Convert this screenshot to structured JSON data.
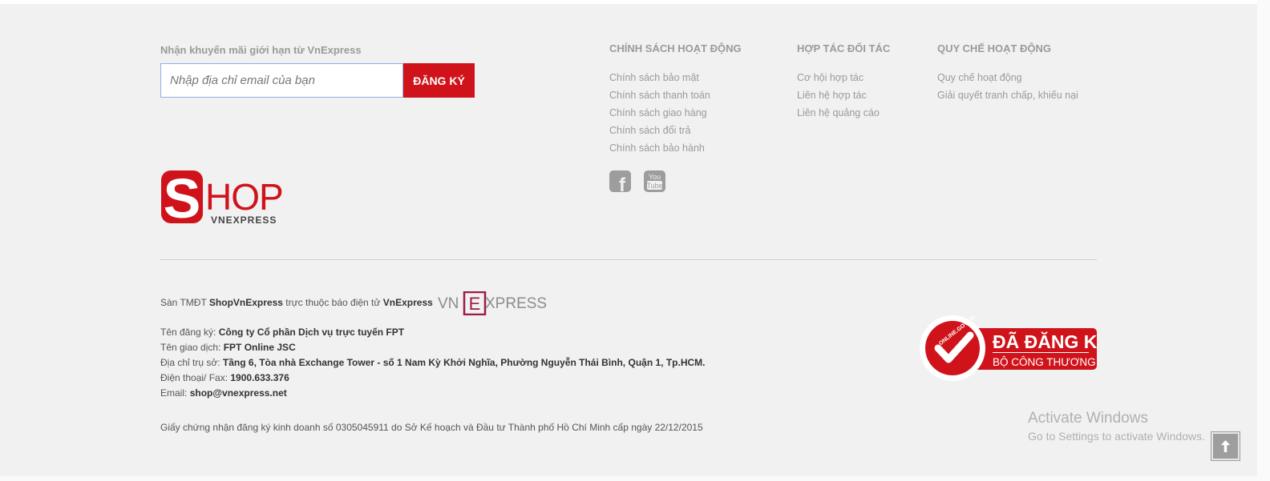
{
  "newsletter": {
    "title": "Nhận khuyến mãi giới hạn từ VnExpress",
    "placeholder": "Nhập địa chỉ email của bạn",
    "button_label": "ĐĂNG KÝ"
  },
  "logo": {
    "letter": "S",
    "word": "HOP",
    "sub": "VNEXPRESS"
  },
  "columns": [
    {
      "title": "CHÍNH SÁCH HOẠT ĐỘNG",
      "links": [
        "Chính sách bảo mật",
        "Chính sách thanh toán",
        "Chính sách giao hàng",
        "Chính sách đổi trả",
        "Chính sách bảo hành"
      ]
    },
    {
      "title": "HỢP TÁC ĐỐI TÁC",
      "links": [
        "Cơ hội hợp tác",
        "Liên hệ hợp tác",
        "Liên hệ quảng cáo"
      ]
    },
    {
      "title": "QUY CHẾ HOẠT ĐỘNG",
      "links": [
        "Quy chế hoạt động",
        "Giải quyết tranh chấp, khiếu nại"
      ]
    }
  ],
  "social": {
    "facebook_glyph": "f",
    "youtube_line1": "You",
    "youtube_line2": "Tube"
  },
  "company": {
    "intro_prefix": "Sàn TMĐT ",
    "intro_brand": "ShopVnExpress",
    "intro_mid": " trực thuộc báo điện tử ",
    "intro_paper": "VnExpress",
    "vne_logo_left": "VN",
    "vne_logo_mid": "E",
    "vne_logo_right": "XPRESS",
    "reg_name_label": "Tên đăng ký: ",
    "reg_name": "Công ty Cổ phần Dịch vụ trực tuyến FPT",
    "trade_name_label": "Tên giao dịch: ",
    "trade_name": "FPT Online JSC",
    "address_label": "Địa chỉ trụ sở: ",
    "address": "Tầng 6, Tòa nhà Exchange Tower - số 1 Nam Kỳ Khởi Nghĩa, Phường Nguyễn Thái Bình, Quận 1, Tp.HCM.",
    "phone_label": "Điện thoại/ Fax: ",
    "phone": "1900.633.376",
    "email_label": "Email: ",
    "email": "shop@vnexpress.net",
    "license": "Giấy chứng nhận đăng ký kinh doanh số 0305045911 do Sở Kế hoạch và Đầu tư Thành phố Hồ Chí Minh cấp ngày 22/12/2015"
  },
  "badge": {
    "ring_text": "ONLINE.GOV.VN",
    "line1": "ĐÃ ĐĂNG KÝ",
    "line2": "BỘ CÔNG THƯƠNG"
  },
  "os_overlay": {
    "title": "Activate Windows",
    "subtitle": "Go to Settings to activate Windows."
  },
  "colors": {
    "brand_red": "#d0131b",
    "muted_text": "#9a9a9a",
    "footer_bg": "#f1f1f1"
  }
}
